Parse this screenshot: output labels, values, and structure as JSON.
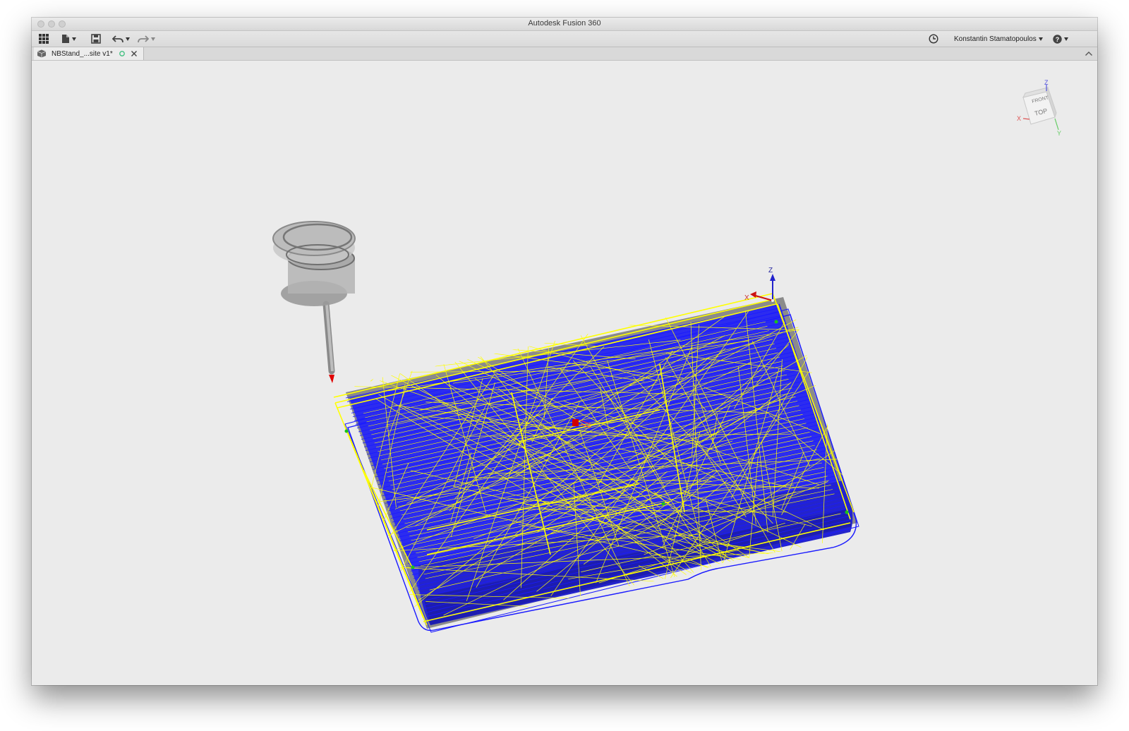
{
  "window": {
    "title": "Autodesk Fusion 360"
  },
  "toolbar": {
    "data_panel_icon": "grid-icon",
    "file_icon": "file-icon",
    "save_icon": "save-icon",
    "undo_icon": "undo-icon",
    "redo_icon": "redo-icon",
    "job_status_icon": "clock-icon",
    "user_name": "Konstantin Stamatopoulos",
    "help_icon": "help-icon"
  },
  "tabs": [
    {
      "label": "NBStand_...site v1*",
      "icon": "component-icon",
      "status_icon": "circle-icon",
      "close_icon": "close-icon"
    }
  ],
  "viewcube": {
    "faces": {
      "top": "TOP",
      "front": "FRONT"
    },
    "axes": {
      "x": "X",
      "y": "Y",
      "z": "Z"
    }
  },
  "origin_triad": {
    "z": "Z",
    "x": "X"
  },
  "colors": {
    "toolpath_cut": "#ffff00",
    "toolpath_link": "#1a1aff",
    "stock": "#8a8a8a",
    "tool_holder": "#9a9a9a",
    "tool_tip": "#e00000",
    "viewport_bg": "#ebebeb"
  }
}
